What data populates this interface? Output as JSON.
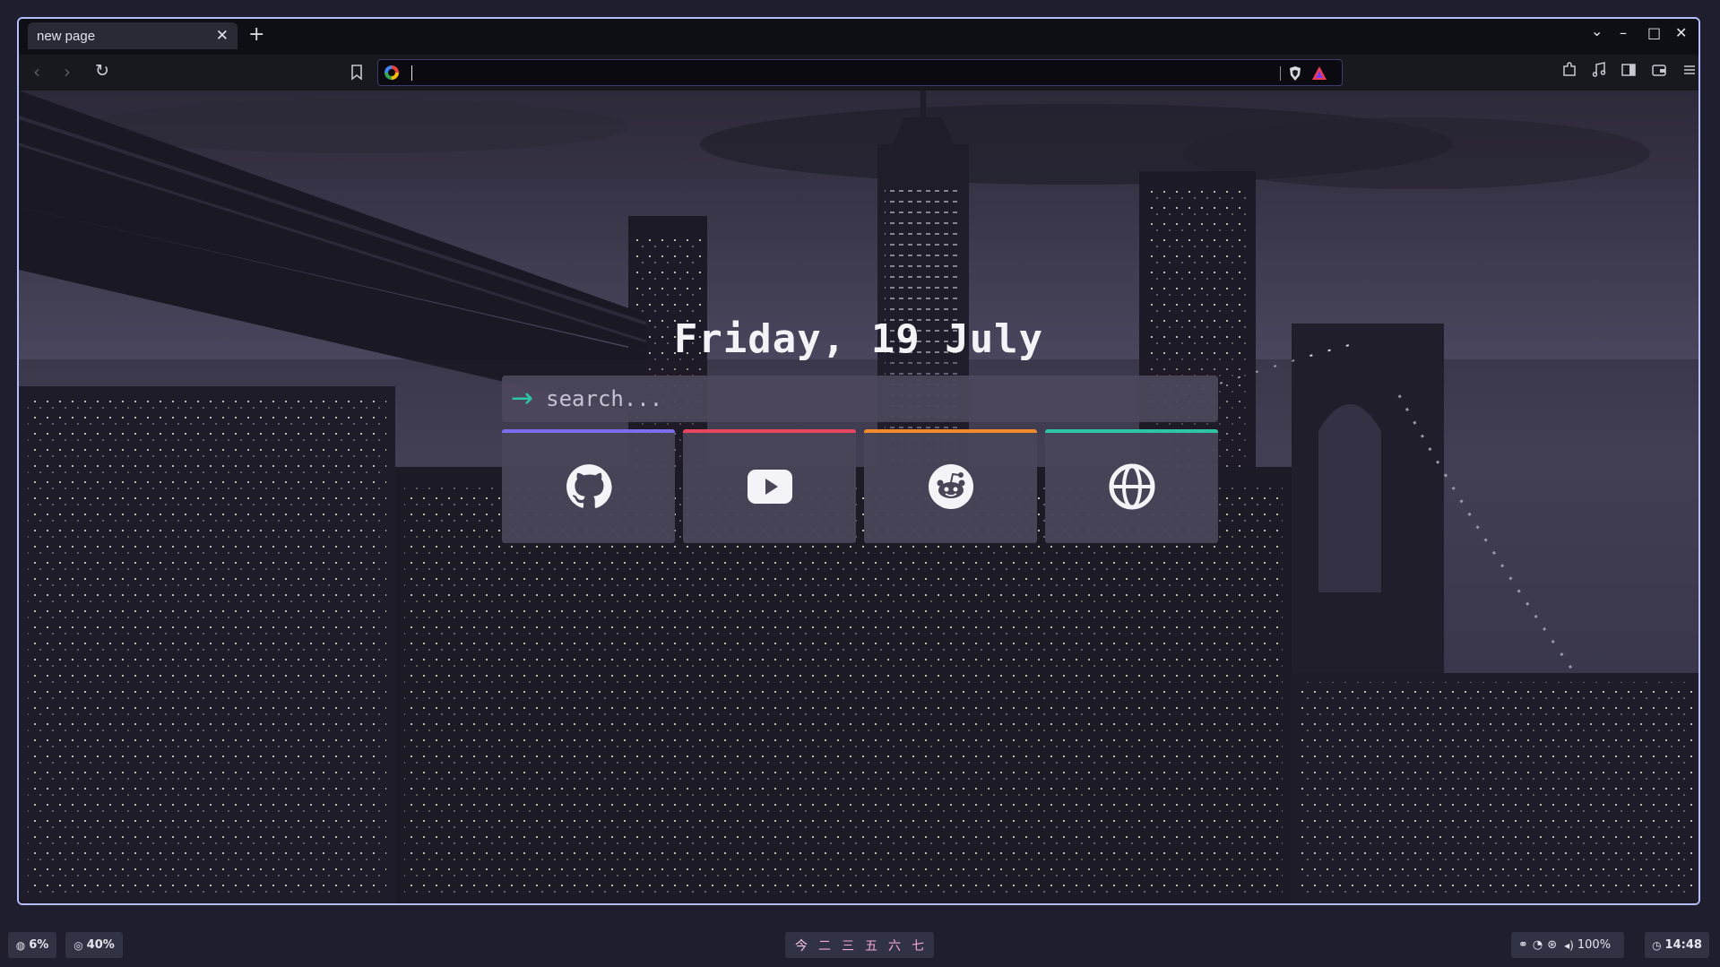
{
  "browser": {
    "tab": {
      "title": "new page",
      "close_glyph": "✕"
    },
    "new_tab_glyph": "+",
    "window_controls": {
      "dropdown": "⌄",
      "minimize": "–",
      "maximize": "□",
      "close": "✕"
    },
    "nav": {
      "back": "‹",
      "forward": "›",
      "reload": "↻"
    },
    "address_bar": {
      "value": "",
      "search_engine_icon": "google-icon"
    },
    "toolbar_icons": [
      "bookmark-icon",
      "brave-shield-icon",
      "brave-rewards-icon",
      "extensions-icon",
      "media-icon",
      "sidebar-icon",
      "wallet-icon",
      "menu-icon"
    ]
  },
  "newtab": {
    "date": "Friday, 19 July",
    "search": {
      "placeholder": "search...",
      "arrow": "→"
    },
    "shortcuts": [
      {
        "name": "GitHub",
        "icon": "github-icon",
        "accent": "#7b6cf0"
      },
      {
        "name": "YouTube",
        "icon": "youtube-icon",
        "accent": "#e84560"
      },
      {
        "name": "Reddit",
        "icon": "reddit-icon",
        "accent": "#f08a2a"
      },
      {
        "name": "Web",
        "icon": "globe-icon",
        "accent": "#2ec4a6"
      }
    ]
  },
  "taskbar": {
    "cpu": {
      "icon": "cpu-icon",
      "value": "6%"
    },
    "memory": {
      "icon": "memory-icon",
      "value": "40%"
    },
    "workspaces": [
      "今",
      "二",
      "三",
      "五",
      "六",
      "七"
    ],
    "tray_icons": [
      "network-icon",
      "discord-icon",
      "steam-icon"
    ],
    "volume": {
      "icon": "speaker-icon",
      "value": "100%"
    },
    "clock": {
      "icon": "clock-icon",
      "value": "14:48"
    }
  },
  "colors": {
    "window_border": "#b4befe",
    "search_accent": "#2ec4a6",
    "taskbar_bg": "#1e1e2e",
    "workspace_text": "#f5a9d4"
  }
}
